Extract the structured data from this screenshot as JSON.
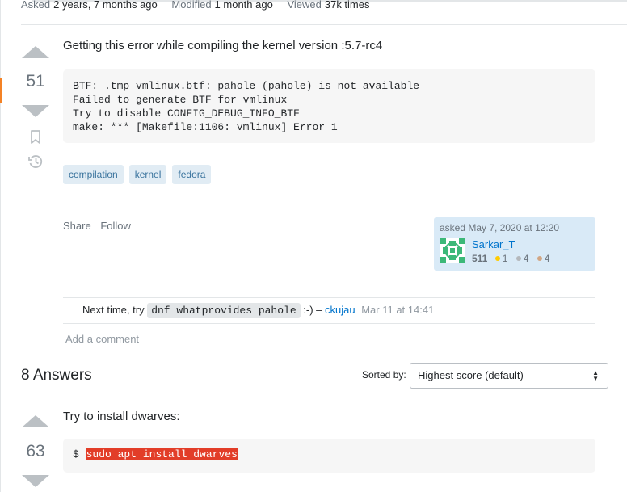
{
  "meta": {
    "asked_label": "Asked",
    "asked_value": "2 years, 7 months ago",
    "modified_label": "Modified",
    "modified_value": "1 month ago",
    "viewed_label": "Viewed",
    "viewed_value": "37k times"
  },
  "question": {
    "score": "51",
    "title": "Getting this error while compiling the kernel version :5.7-rc4",
    "code": "BTF: .tmp_vmlinux.btf: pahole (pahole) is not available\nFailed to generate BTF for vmlinux\nTry to disable CONFIG_DEBUG_INFO_BTF\nmake: *** [Makefile:1106: vmlinux] Error 1",
    "tags": [
      "compilation",
      "kernel",
      "fedora"
    ],
    "share_label": "Share",
    "follow_label": "Follow",
    "author": {
      "asked_text": "asked May 7, 2020 at 12:20",
      "name": "Sarkar_T",
      "reputation": "511",
      "gold": "1",
      "silver": "4",
      "bronze": "4",
      "colors": {
        "gold": "#ffcc01",
        "silver": "#b4b8bc",
        "bronze": "#d1a684",
        "card": "#d9eaf7",
        "avatar": "#3cb878"
      }
    }
  },
  "comment": {
    "pre": "Next time, try",
    "code": "dnf whatprovides pahole",
    "post": ":-) –",
    "user": "ckujau",
    "date": "Mar 11 at 14:41"
  },
  "add_comment_label": "Add a comment",
  "answers": {
    "count": "8",
    "label": "Answers",
    "sort_label": "Sorted by:",
    "sort_selected": "Highest score (default)",
    "first": {
      "score": "63",
      "text": "Try to install dwarves:",
      "prompt": "$",
      "command": "sudo apt install dwarves"
    }
  },
  "icons": {
    "bookmark": "bookmark-icon",
    "history": "history-icon",
    "vote_up": "upvote-icon",
    "vote_down": "downvote-icon"
  }
}
